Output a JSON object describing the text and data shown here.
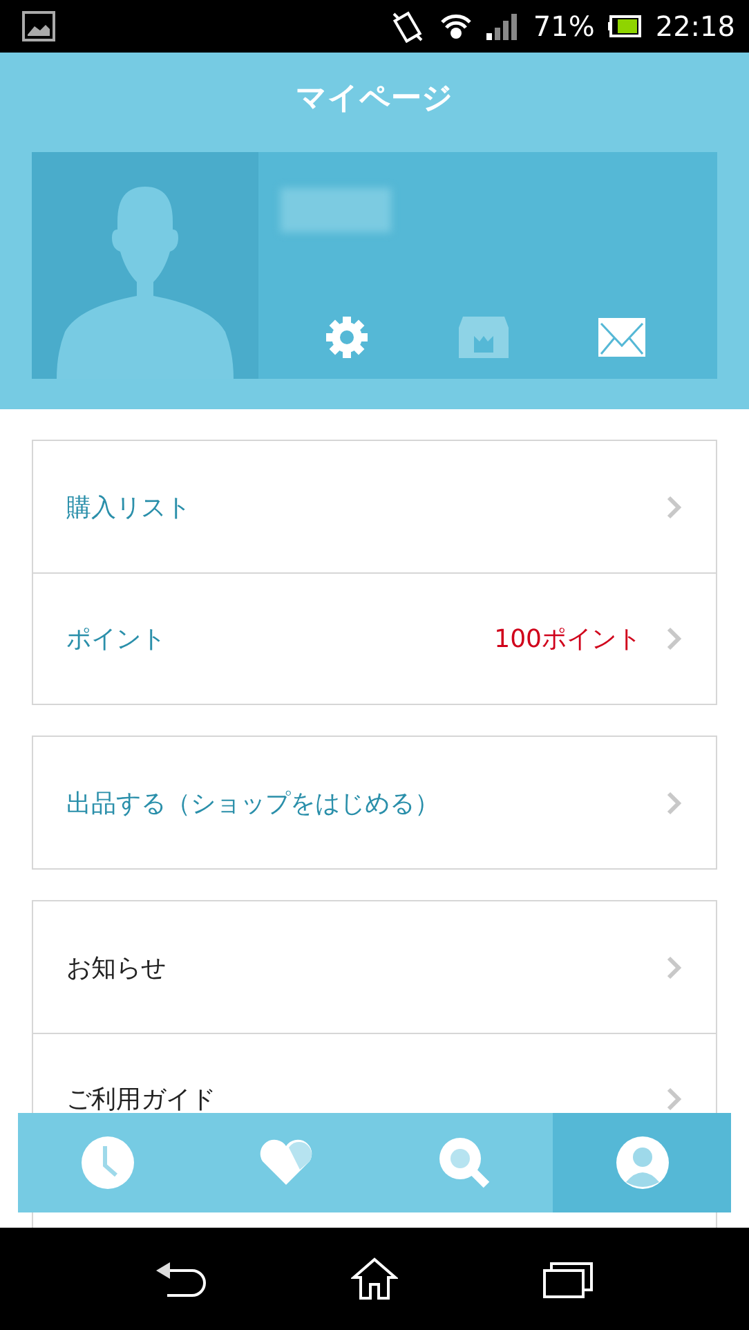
{
  "status_bar": {
    "battery": "71%",
    "time": "22:18"
  },
  "header": {
    "title": "マイページ"
  },
  "menu_groups": [
    {
      "items": [
        {
          "label": "購入リスト",
          "accent": true
        },
        {
          "label": "ポイント",
          "accent": true,
          "value": "100ポイント"
        }
      ]
    },
    {
      "items": [
        {
          "label": "出品する（ショップをはじめる）",
          "accent": true
        }
      ]
    },
    {
      "items": [
        {
          "label": "お知らせ",
          "accent": false
        },
        {
          "label": "ご利用ガイド",
          "accent": false
        }
      ]
    }
  ],
  "bottom_tabs": [
    {
      "kind": "history",
      "selected": false
    },
    {
      "kind": "favorites",
      "selected": false
    },
    {
      "kind": "search",
      "selected": false
    },
    {
      "kind": "mypage",
      "selected": true
    }
  ]
}
